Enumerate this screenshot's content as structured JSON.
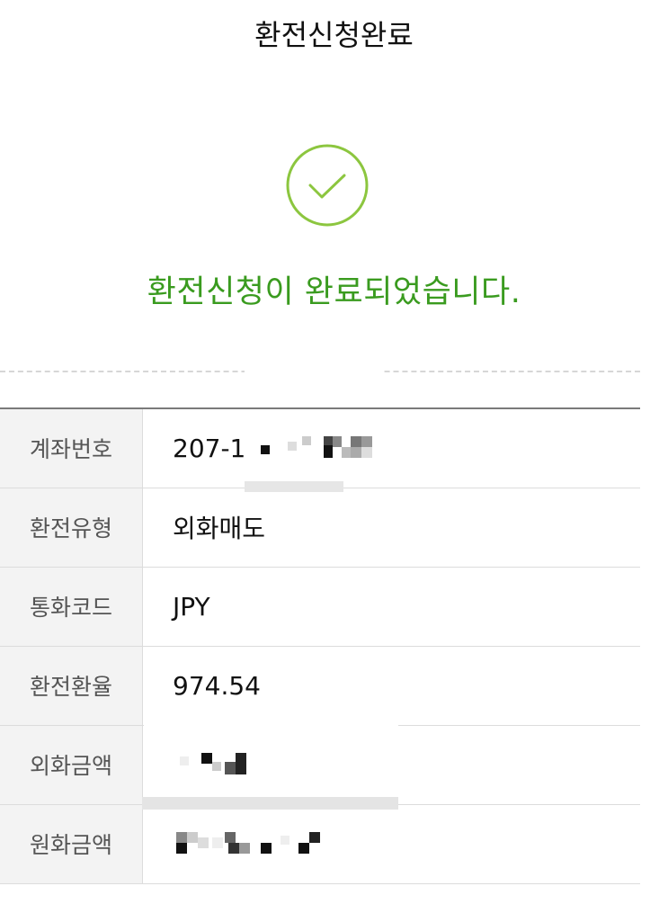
{
  "header": {
    "title": "환전신청완료"
  },
  "result": {
    "message": "환전신청이 완료되었습니다.",
    "icon": "check-circle-icon",
    "accent_color": "#3a9b1f"
  },
  "details": {
    "rows": [
      {
        "label": "계좌번호",
        "value": "207-1"
      },
      {
        "label": "환전유형",
        "value": "외화매도"
      },
      {
        "label": "통화코드",
        "value": "JPY"
      },
      {
        "label": "환전환율",
        "value": "974.54"
      },
      {
        "label": "외화금액",
        "value": ""
      },
      {
        "label": "원화금액",
        "value": ""
      }
    ]
  }
}
